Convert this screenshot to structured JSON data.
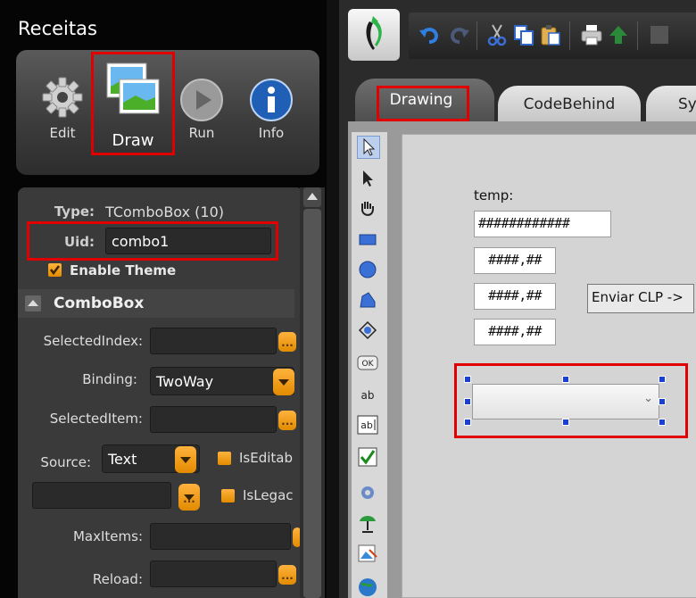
{
  "panel": {
    "title": "Receitas",
    "ribbon": {
      "edit_label": "Edit",
      "draw_label": "Draw",
      "run_label": "Run",
      "info_label": "Info"
    }
  },
  "properties": {
    "type_label": "Type:",
    "type_value": "TComboBox (10)",
    "uid_label": "Uid:",
    "uid_value": "combo1",
    "enable_theme_label": "Enable Theme",
    "section_title": "ComboBox",
    "selected_index_label": "SelectedIndex:",
    "binding_label": "Binding:",
    "binding_value": "TwoWay",
    "selected_item_label": "SelectedItem:",
    "source_label": "Source:",
    "source_value": "Text",
    "is_editable_label": "IsEditab",
    "is_legacy_label": "IsLegac",
    "max_items_label": "MaxItems:",
    "reload_label": "Reload:",
    "dots_label": "..."
  },
  "tabs": {
    "drawing": "Drawing",
    "codebehind": "CodeBehind",
    "sys": "Sy"
  },
  "design": {
    "temp_label": "temp:",
    "field1": "############",
    "field2": "####,##",
    "field3": "####,##",
    "field4": "####,##",
    "send_button": "Enviar CLP ->"
  },
  "icons": {
    "edit": "gear-icon",
    "draw": "pictures-icon",
    "run": "play-icon",
    "info": "info-icon",
    "undo": "undo-icon",
    "redo": "redo-icon",
    "cut": "scissors-icon",
    "copy": "copy-icon",
    "paste": "paste-icon",
    "print": "printer-icon",
    "up": "up-arrow-icon"
  },
  "colors": {
    "highlight": "#e00000",
    "accent_orange": "#f0a020",
    "selection_handle": "#1a3fd6"
  }
}
